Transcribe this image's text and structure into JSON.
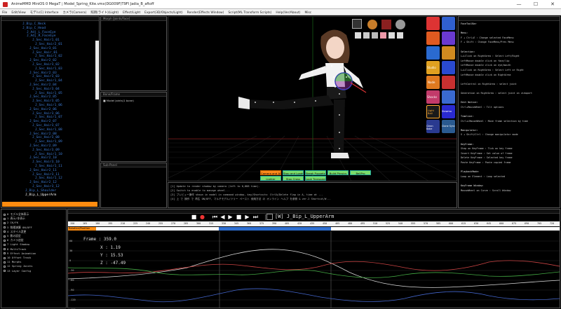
{
  "window": {
    "title": "AnimeMMD MiniOS 0  MegaT  ¦ Model_Spring_Kite.vmx(DG009F)T9FI  Jadia_B_aftoff",
    "minimize_glyph": "—",
    "maximize_glyph": "☐",
    "close_glyph": "✕"
  },
  "menu": {
    "items": [
      "File",
      "Edit/View",
      "モデル(C) Interface",
      "カメラ(Camera)",
      "照明(ライト)(Light)",
      "Effect/Light",
      "Export(3D/Objects/Light)",
      "Render(Effects Window)",
      "Script(ML Transform Scripts)",
      "Help(Ver/About)",
      "Misc"
    ]
  },
  "tree": {
    "items": [
      {
        "label": "J_Bip_C_Neck",
        "sel": false
      },
      {
        "label": "J_Bip_C_Head",
        "sel": false
      },
      {
        "label": "J_Adj_L_FaceEye",
        "sel": false
      },
      {
        "label": "J_Adj_R_FaceEye",
        "sel": false
      },
      {
        "label": "J_Sec_Hair1_01",
        "sel": false
      },
      {
        "label": "J_Sec_Hair2_01",
        "sel": false
      },
      {
        "label": "J_Sec_Hair3_01",
        "sel": false
      },
      {
        "label": "J_Sec_Hair_01",
        "sel": false
      },
      {
        "label": "J_Sec_Hair1_02",
        "sel": false
      },
      {
        "label": "J_Sec_Hair2_02",
        "sel": false
      },
      {
        "label": "J_Sec_Hair3_02",
        "sel": false
      },
      {
        "label": "J_Sec_Hair1_03",
        "sel": false
      },
      {
        "label": "J_Sec_Hair2_03",
        "sel": false
      },
      {
        "label": "J_Sec_Hair3_03",
        "sel": false
      },
      {
        "label": "J_Sec_Hair1_04",
        "sel": false
      },
      {
        "label": "J_Sec_Hair2_04",
        "sel": false
      },
      {
        "label": "J_Sec_Hair3_04",
        "sel": false
      },
      {
        "label": "J_Sec_Hair1_05",
        "sel": false
      },
      {
        "label": "J_Sec_Hair2_05",
        "sel": false
      },
      {
        "label": "J_Sec_Hair3_05",
        "sel": false
      },
      {
        "label": "J_Sec_Hair1_06",
        "sel": false
      },
      {
        "label": "J_Sec_Hair2_06",
        "sel": false
      },
      {
        "label": "J_Sec_Hair3_06",
        "sel": false
      },
      {
        "label": "J_Sec_Hair1_07",
        "sel": false
      },
      {
        "label": "J_Sec_Hair2_07",
        "sel": false
      },
      {
        "label": "J_Sec_Hair3_07",
        "sel": false
      },
      {
        "label": "J_Sec_Hair1_08",
        "sel": false
      },
      {
        "label": "J_Sec_Hair2_08",
        "sel": false
      },
      {
        "label": "J_Sec_Hair3_08",
        "sel": false
      },
      {
        "label": "J_Sec_Hair1_09",
        "sel": false
      },
      {
        "label": "J_Sec_Hair2_09",
        "sel": false
      },
      {
        "label": "J_Sec_Hair3_09",
        "sel": false
      },
      {
        "label": "J_Sec_Hair1_10",
        "sel": false
      },
      {
        "label": "J_Sec_Hair2_10",
        "sel": false
      },
      {
        "label": "J_Sec_Hair3_10",
        "sel": false
      },
      {
        "label": "J_Sec_Hair1_11",
        "sel": false
      },
      {
        "label": "J_Sec_Hair2_11",
        "sel": false
      },
      {
        "label": "J_Sec_Hair3_11",
        "sel": false
      },
      {
        "label": "J_Sec_Hair1_12",
        "sel": false
      },
      {
        "label": "J_Sec_Hair2_12",
        "sel": false
      },
      {
        "label": "J_Sec_Hair3_12",
        "sel": false
      },
      {
        "label": "J_Bip_L_Shoulder",
        "sel": false
      },
      {
        "label": "J_Bip_L_UpperArm",
        "sel": true
      }
    ]
  },
  "mid_panels": {
    "morph_header": "Morph  [Joints/Face]",
    "bone_header": "Bone/Frame",
    "bone_item": "■ Model Joints(1 bone)",
    "third_header": "Sub-Panel"
  },
  "viewport": {
    "buttons_row1": [
      "Camera and Al",
      "Stop and Loads",
      "Break Puppets",
      "Build Physics",
      "BellPro"
    ],
    "buttons_row2": [
      "Lighter",
      "Stop Cross",
      "Look Transparent"
    ]
  },
  "log": {
    "lines": [
      "[1] Update to render shadow by camera (left to 0,888 time).",
      "[2] Switch to enable to manage wheel...",
      "[3] プレビュー操作 shown in model in command window, key/Shortcuts: CtrlA/Delete flag in A, time at ...",
      "[4] 上 で 操作 で 再生 ON/OFF, マルチモデル/ツリー ペースト 使用方法 の オンライン ヘルプ を参照 & ver.2 Shortcut/W..."
    ]
  },
  "right_tools": {
    "labels": [
      "Studio",
      "Node",
      "Shocks",
      "Light Ball",
      "Slowmo",
      "Clean Bake",
      "Clone Sync"
    ]
  },
  "help": {
    "lines": [
      {
        "t": "FaceToolBar",
        "head": true
      },
      {
        "t": "",
        "head": false
      },
      {
        "t": "Menu:",
        "head": true
      },
      {
        "t": "  F + Ctrl+E   : Change selected FaceMenu",
        "head": false
      },
      {
        "t": "  F + Shift    : Change FaceMenu/Prev Menu",
        "head": false
      },
      {
        "t": "",
        "head": false
      },
      {
        "t": "Selection:",
        "head": true
      },
      {
        "t": "  L+LClick on RightArea : Select Left/Right",
        "head": false
      },
      {
        "t": "    LeftMouse double click on face/lip",
        "head": false
      },
      {
        "t": "    LeftMouse double click on eye/mouth",
        "head": false
      },
      {
        "t": "  L+LClick on RightArea : Select Left or Right",
        "head": false
      },
      {
        "t": "    LeftMouse double click on RightArea",
        "head": false
      },
      {
        "t": "",
        "head": false
      },
      {
        "t": "  LeftControl on RightArea : select joint",
        "head": false
      },
      {
        "t": "",
        "head": false
      },
      {
        "t": "  Generation on RightArea : select joint on viewport",
        "head": false
      },
      {
        "t": "",
        "head": false
      },
      {
        "t": "Edit Notice:",
        "head": true
      },
      {
        "t": "  Ctrl+MouseWheel : Tilt options",
        "head": false
      },
      {
        "t": "",
        "head": false
      },
      {
        "t": "Timeline:",
        "head": true
      },
      {
        "t": "  Ctrl+LMouseWheel : Move frame selection by time",
        "head": false
      },
      {
        "t": "",
        "head": false
      },
      {
        "t": "Manipulator:",
        "head": true
      },
      {
        "t": "  V + Shift/Ctrl : Change manipulator mode",
        "head": false
      },
      {
        "t": "",
        "head": false
      },
      {
        "t": "KeyFrame:",
        "head": true
      },
      {
        "t": "  Step on KeyFrame   : Tick on key frame",
        "head": false
      },
      {
        "t": "  Insert KeyFrame    : Set value of frame",
        "head": false
      },
      {
        "t": "  Delete KeyFrame    : Selected key frame",
        "head": false
      },
      {
        "t": "  Paste KeyFrame     : Paste copied frame",
        "head": false
      },
      {
        "t": "",
        "head": false
      },
      {
        "t": "PlaybackMode:",
        "head": true
      },
      {
        "t": "  Loop on Element : Loop selected",
        "head": false
      },
      {
        "t": "",
        "head": false
      },
      {
        "t": "KeyFrame Window:",
        "head": true
      },
      {
        "t": "  MouseWheel on Curve : Scroll Window",
        "head": false
      }
    ]
  },
  "layers": {
    "lines": [
      "0 モデル全体表示",
      "1 表示/非表示",
      "2 IK/FK",
      "3 物理演算 ON/OFF",
      "4 スタイル変更",
      "5 影の設定",
      "6 カメラ追従",
      "7 Light Shadow",
      "8 MultiTrack",
      "9 Effect Animation",
      "10 Offset Track",
      "11 Morphs",
      "12 Spring Joints",
      "13 Layer Config"
    ]
  },
  "timeline": {
    "bone_name": "[W]  J_Bip_L_UpperArm",
    "track_label": "Rotation/Position",
    "frame_label": "Frame : 359.0",
    "x_label": "X : 1.19",
    "y_label": "Y : 15.53",
    "z_label": "Z : -47.49",
    "ruler_labels": [
      "150",
      "165",
      "180",
      "195",
      "210",
      "225",
      "240",
      "255",
      "270",
      "285",
      "300",
      "315",
      "330",
      "345",
      "360",
      "375",
      "390",
      "405",
      "420",
      "435",
      "450",
      "465",
      "480",
      "495",
      "510",
      "525",
      "540",
      "555",
      "570",
      "585",
      "600",
      "615",
      "630",
      "645",
      "660",
      "675",
      "690",
      "705",
      "720"
    ],
    "y_ticks": [
      "60",
      "30",
      "0",
      "-30",
      "-60",
      "-90",
      "-120",
      "-150"
    ]
  },
  "colors": {
    "accent_orange": "#ff8c10",
    "timeline_blue": "#2f6fd0",
    "tree_blue": "#3f7fd9",
    "curve_white": "#d8d8d8",
    "curve_red": "#c44",
    "curve_green": "#4a4",
    "curve_blue": "#46c"
  }
}
